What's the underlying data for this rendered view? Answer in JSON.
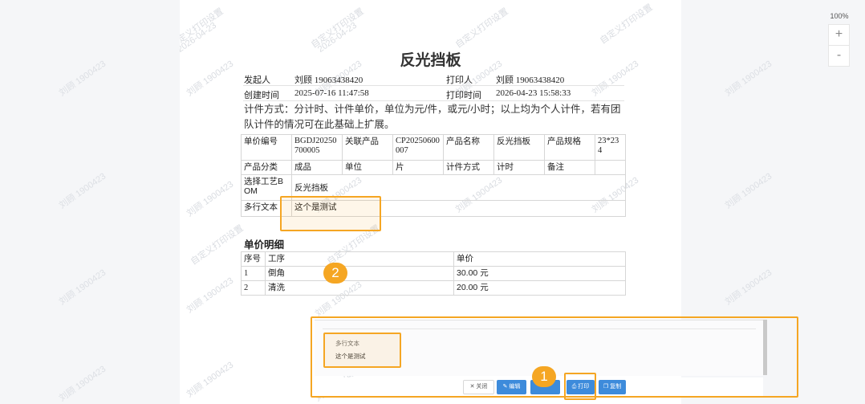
{
  "document": {
    "title": "反光挡板",
    "initiator_label": "发起人",
    "initiator_value": "刘顾 19063438420",
    "printer_label": "打印人",
    "printer_value": "刘顾 19063438420",
    "created_label": "创建时间",
    "created_value": "2025-07-16 11:47:58",
    "printed_label": "打印时间",
    "printed_value": "2026-04-23 15:58:33",
    "description": "计件方式：分计时、计件单价，单位为元/件，或元/小时；以上均为个人计件，若有团队计件的情况可在此基础上扩展。",
    "info": {
      "r1": [
        "单价编号",
        "BGDJ20250700005",
        "关联产品",
        "CP20250600007",
        "产品名称",
        "反光挡板",
        "产品规格",
        "23*234"
      ],
      "r2": [
        "产品分类",
        "成品",
        "单位",
        "片",
        "计件方式",
        "计时",
        "备注",
        ""
      ],
      "r3": [
        "选择工艺BOM",
        "反光挡板"
      ],
      "r4": [
        "多行文本",
        "这个是测试"
      ]
    },
    "section_title": "单价明细",
    "detail_headers": [
      "序号",
      "工序",
      "单价"
    ],
    "detail_rows": [
      [
        "1",
        "倒角",
        "30.00 元"
      ],
      [
        "2",
        "清洗",
        "20.00 元"
      ]
    ]
  },
  "watermark": {
    "name": "刘顾 1900423",
    "line1": "自定义打印设置",
    "line2": "2026-04-23"
  },
  "zoom": {
    "level": "100%",
    "plus": "+",
    "minus": "-"
  },
  "preview_panel": {
    "field_label": "多行文本",
    "field_value": "这个是测试"
  },
  "buttons": {
    "close": "关闭",
    "edit": "编辑",
    "print": "打印",
    "copy": "复制"
  },
  "badges": {
    "one": "1",
    "two": "2"
  },
  "colors": {
    "highlight": "#f5a623",
    "primary": "#3d8bdb"
  }
}
